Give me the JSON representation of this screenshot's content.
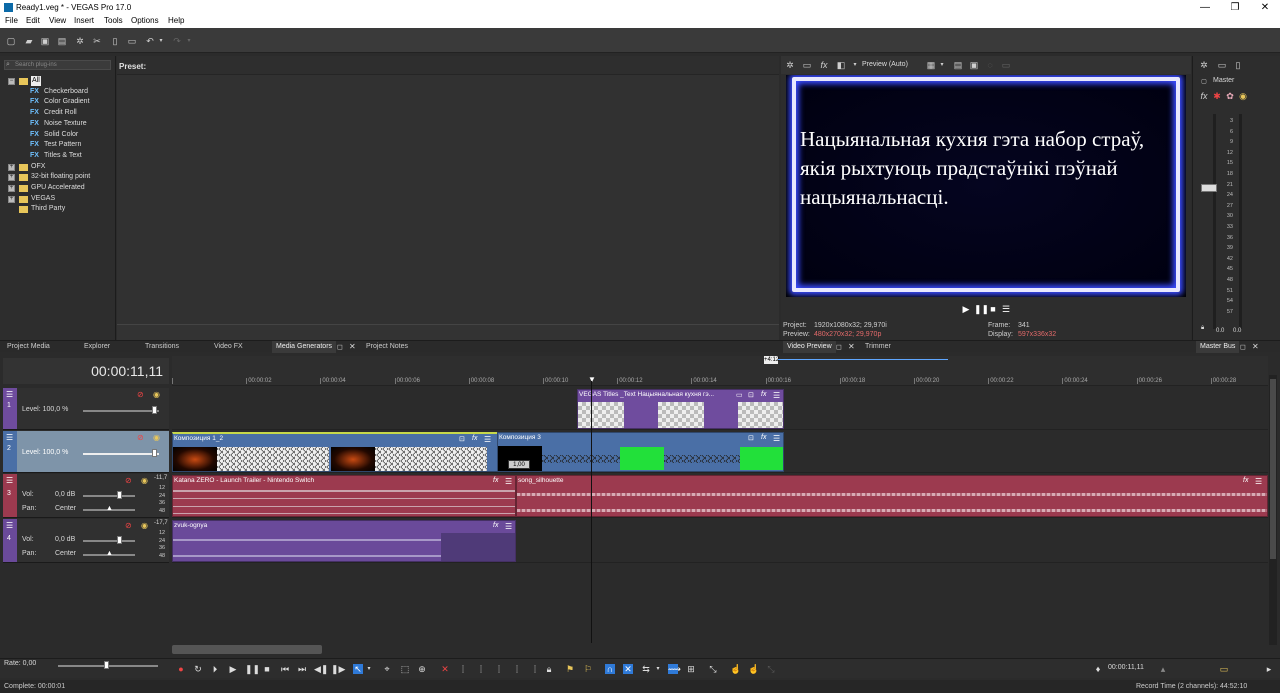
{
  "titlebar": {
    "title": "Ready1.veg * - VEGAS Pro 17.0",
    "minimize": "—",
    "maximize": "❐",
    "close": "✕"
  },
  "menu": [
    "File",
    "Edit",
    "View",
    "Insert",
    "Tools",
    "Options",
    "Help"
  ],
  "plugin_search": {
    "placeholder": "Search plug-ins"
  },
  "preset_label": "Preset:",
  "tree": [
    {
      "label": "All",
      "level": 0,
      "type": "folder",
      "expander": "−"
    },
    {
      "label": "Checkerboard",
      "level": 1,
      "type": "fx"
    },
    {
      "label": "Color Gradient",
      "level": 1,
      "type": "fx"
    },
    {
      "label": "Credit Roll",
      "level": 1,
      "type": "fx"
    },
    {
      "label": "Noise Texture",
      "level": 1,
      "type": "fx"
    },
    {
      "label": "Solid Color",
      "level": 1,
      "type": "fx"
    },
    {
      "label": "Test Pattern",
      "level": 1,
      "type": "fx"
    },
    {
      "label": "Titles & Text",
      "level": 1,
      "type": "fx"
    },
    {
      "label": "OFX",
      "level": 0,
      "type": "folder",
      "expander": "+"
    },
    {
      "label": "32-bit floating point",
      "level": 0,
      "type": "folder",
      "expander": "+"
    },
    {
      "label": "GPU Accelerated",
      "level": 0,
      "type": "folder",
      "expander": "+"
    },
    {
      "label": "VEGAS",
      "level": 0,
      "type": "folder",
      "expander": "+"
    },
    {
      "label": "Third Party",
      "level": 0,
      "type": "folder",
      "expander": ""
    }
  ],
  "fx_badge": "FX",
  "preview": {
    "mode_label": "Preview (Auto)",
    "text": "Нацыянальная кухня гэта набор страў, якія рыхтуюць прадстаўнікі пэўнай нацыянальнасці.",
    "project_label": "Project:",
    "project_value": "1920x1080x32; 29,970i",
    "preview_label": "Preview:",
    "preview_value": "480x270x32; 29,970p",
    "frame_label": "Frame:",
    "frame_value": "341",
    "display_label": "Display:",
    "display_value": "597x336x32"
  },
  "master": {
    "label": "Master",
    "scale": [
      "3",
      "6",
      "9",
      "12",
      "15",
      "18",
      "21",
      "24",
      "27",
      "30",
      "33",
      "36",
      "39",
      "42",
      "45",
      "48",
      "51",
      "54",
      "57"
    ],
    "left_value": "0.0",
    "right_value": "0.0"
  },
  "tabs_left": [
    "Project Media",
    "Explorer",
    "Transitions",
    "Video FX",
    "Media Generators",
    "Project Notes"
  ],
  "tabs_preview": [
    "Video Preview",
    "Trimmer"
  ],
  "tab_master": "Master Bus",
  "timeline": {
    "timecode": "00:00:11,11",
    "ruler_badge": "+4:12",
    "ruler_labels": [
      "00:00:00",
      "00:00:02",
      "00:00:04",
      "00:00:06",
      "00:00:08",
      "00:00:10",
      "00:00:12",
      "00:00:14",
      "00:00:16",
      "00:00:18",
      "00:00:20",
      "00:00:22",
      "00:00:24",
      "00:00:26",
      "00:00:28"
    ],
    "tracks": [
      {
        "num": "1",
        "level_label": "Level: 100,0 %",
        "color": "#6f4c9e"
      },
      {
        "num": "2",
        "level_label": "Level: 100,0 %",
        "color": "#4a6fa6"
      },
      {
        "num": "3",
        "vol_label": "Vol:",
        "vol_value": "0,0 dB",
        "pan_label": "Pan:",
        "pan_value": "Center",
        "peak": "-11,7",
        "color": "#9c3a4f"
      },
      {
        "num": "4",
        "vol_label": "Vol:",
        "vol_value": "0,0 dB",
        "pan_label": "Pan:",
        "pan_value": "Center",
        "peak": "-17,7",
        "color": "#6a4a9a"
      }
    ],
    "db_scale": [
      "12",
      "24",
      "36",
      "48"
    ],
    "clips": {
      "title_clip": "VEGAS Titles _Text Нацыянальная кухня гэ...",
      "comp1": "Композиция 1_2",
      "comp3": "Композиция 3",
      "comp_badge": "1,00",
      "audio1": "Katana ZERO - Launch Trailer - Nintendo Switch",
      "audio2": "song_silhouette",
      "audio3": "zvuk-ognya"
    }
  },
  "bottom": {
    "rate_label": "Rate: 0,00",
    "cursor_time": "00:00:11,11",
    "status_left": "Complete: 00:00:01",
    "status_right": "Record Time (2 channels): 44:52:10"
  },
  "colors": {
    "video_track": "#4a6fa6",
    "title_track": "#6f4c9e",
    "audio_track": "#9c3a4f",
    "audio_track2": "#6a4a9a",
    "accent_blue": "#2f7ad8"
  }
}
